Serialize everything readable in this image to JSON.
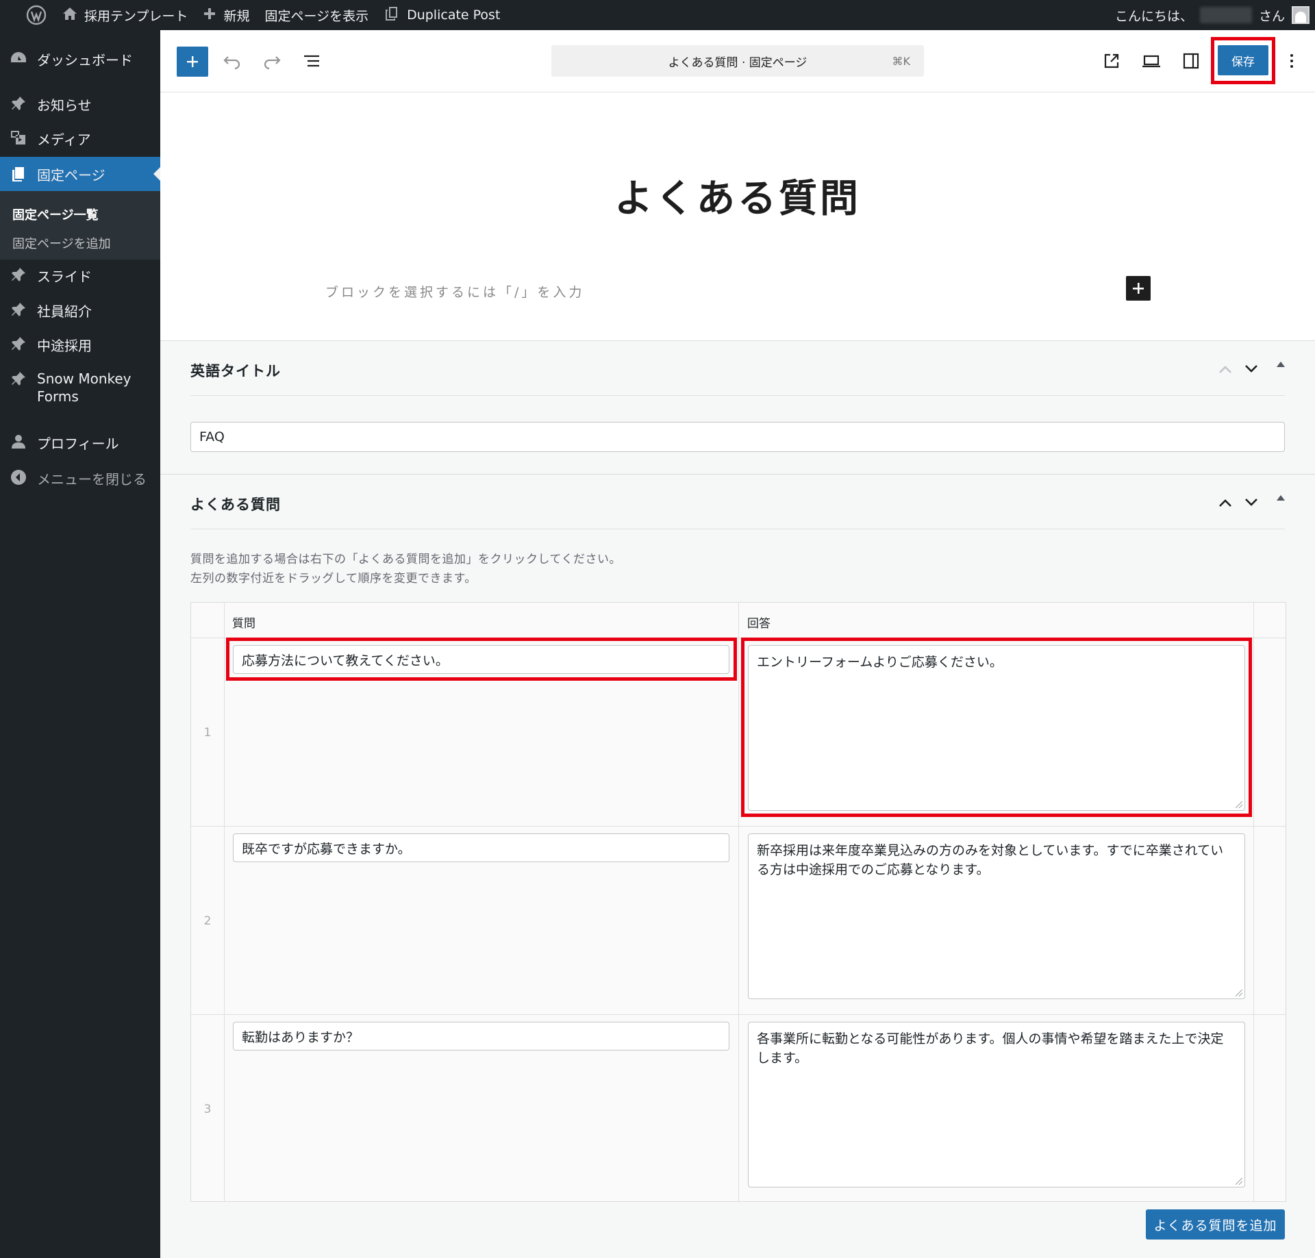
{
  "adminbar": {
    "site_name": "採用テンプレート",
    "new_label": "新規",
    "view_page": "固定ページを表示",
    "duplicate": "Duplicate Post",
    "greeting": "こんにちは、",
    "greeting_suffix": "さん"
  },
  "sidebar": {
    "items": [
      {
        "label": "ダッシュボード",
        "icon": "dashboard-icon"
      },
      {
        "label": "お知らせ",
        "icon": "pin-icon"
      },
      {
        "label": "メディア",
        "icon": "media-icon"
      },
      {
        "label": "固定ページ",
        "icon": "page-icon"
      },
      {
        "label": "スライド",
        "icon": "pin-icon"
      },
      {
        "label": "社員紹介",
        "icon": "pin-icon"
      },
      {
        "label": "中途採用",
        "icon": "pin-icon"
      },
      {
        "label": "Snow Monkey Forms",
        "icon": "pin-icon"
      },
      {
        "label": "プロフィール",
        "icon": "user-icon"
      },
      {
        "label": "メニューを閉じる",
        "icon": "collapse-icon"
      }
    ],
    "submenu": {
      "current": "固定ページ一覧",
      "add": "固定ページを追加"
    }
  },
  "header": {
    "doc_title": "よくある質問 · 固定ページ",
    "shortcut": "⌘K",
    "save_label": "保存"
  },
  "canvas": {
    "title": "よくある質問",
    "placeholder": "ブロックを選択するには「/」を入力"
  },
  "meta_english": {
    "title": "英語タイトル",
    "value": "FAQ"
  },
  "meta_faq": {
    "title": "よくある質問",
    "desc_line1": "質問を追加する場合は右下の「よくある質問を追加」をクリックしてください。",
    "desc_line2": "左列の数字付近をドラッグして順序を変更できます。",
    "col_question": "質問",
    "col_answer": "回答",
    "rows": [
      {
        "num": "1",
        "question": "応募方法について教えてください。",
        "answer": "エントリーフォームよりご応募ください。"
      },
      {
        "num": "2",
        "question": "既卒ですが応募できますか。",
        "answer": "新卒採用は来年度卒業見込みの方のみを対象としています。すでに卒業されている方は中途採用でのご応募となります。"
      },
      {
        "num": "3",
        "question": "転勤はありますか？",
        "answer": "各事業所に転勤となる可能性があります。個人の事情や希望を踏まえた上で決定します。"
      }
    ],
    "add_button": "よくある質問を追加"
  },
  "colors": {
    "admin_dark": "#1d2327",
    "accent_blue": "#2271b1",
    "highlight_red": "#e60012"
  }
}
